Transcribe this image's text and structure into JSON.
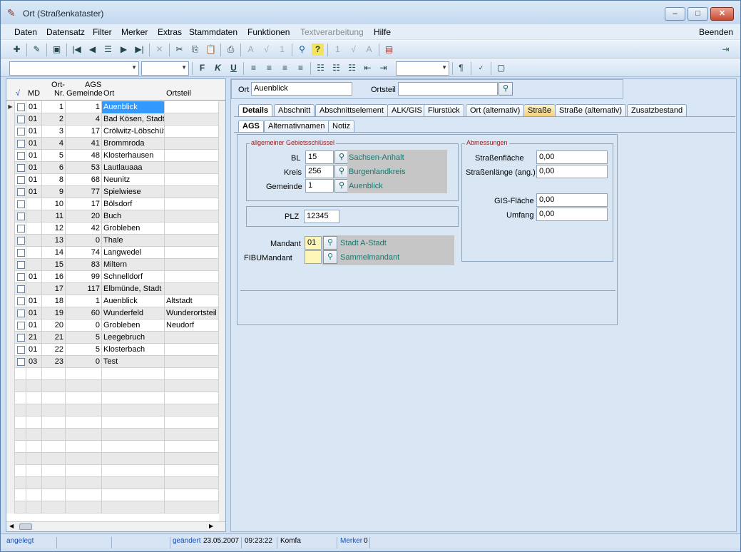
{
  "window": {
    "title": "Ort (Straßenkataster)"
  },
  "menu": {
    "items": [
      "Daten",
      "Datensatz",
      "Filter",
      "Merker",
      "Extras",
      "Stammdaten",
      "Funktionen",
      "Textverarbeitung",
      "Hilfe"
    ],
    "disabled": "Textverarbeitung",
    "exit": "Beenden"
  },
  "grid": {
    "headers": {
      "check": "√",
      "md": "MD",
      "nr_top": "Ort-",
      "nr_bottom": "Nr.",
      "ags_top": "AGS",
      "ags_bottom": "Gemeinde",
      "ort": "Ort",
      "ortsteil": "Ortsteil"
    },
    "rows": [
      {
        "md": "01",
        "nr": "1",
        "ags": "1",
        "ort": "Auenblick",
        "ortsteil": ""
      },
      {
        "md": "01",
        "nr": "2",
        "ags": "4",
        "ort": "Bad Kösen, Stadt",
        "ortsteil": ""
      },
      {
        "md": "01",
        "nr": "3",
        "ags": "17",
        "ort": "Crölwitz-Löbschütz",
        "ortsteil": ""
      },
      {
        "md": "01",
        "nr": "4",
        "ags": "41",
        "ort": "Brommroda",
        "ortsteil": ""
      },
      {
        "md": "01",
        "nr": "5",
        "ags": "48",
        "ort": "Klosterhausen",
        "ortsteil": ""
      },
      {
        "md": "01",
        "nr": "6",
        "ags": "53",
        "ort": "Lautlauaaa",
        "ortsteil": ""
      },
      {
        "md": "01",
        "nr": "8",
        "ags": "68",
        "ort": "Neunitz",
        "ortsteil": ""
      },
      {
        "md": "01",
        "nr": "9",
        "ags": "77",
        "ort": "Spielwiese",
        "ortsteil": ""
      },
      {
        "md": "",
        "nr": "10",
        "ags": "17",
        "ort": "Bölsdorf",
        "ortsteil": ""
      },
      {
        "md": "",
        "nr": "11",
        "ags": "20",
        "ort": "Buch",
        "ortsteil": ""
      },
      {
        "md": "",
        "nr": "12",
        "ags": "42",
        "ort": "Grobleben",
        "ortsteil": ""
      },
      {
        "md": "",
        "nr": "13",
        "ags": "0",
        "ort": "Thale",
        "ortsteil": ""
      },
      {
        "md": "",
        "nr": "14",
        "ags": "74",
        "ort": "Langwedel",
        "ortsteil": ""
      },
      {
        "md": "",
        "nr": "15",
        "ags": "83",
        "ort": "Miltern",
        "ortsteil": ""
      },
      {
        "md": "01",
        "nr": "16",
        "ags": "99",
        "ort": "Schnelldorf",
        "ortsteil": ""
      },
      {
        "md": "",
        "nr": "17",
        "ags": "117",
        "ort": "Elbmünde, Stadt",
        "ortsteil": ""
      },
      {
        "md": "01",
        "nr": "18",
        "ags": "1",
        "ort": "Auenblick",
        "ortsteil": "Altstadt"
      },
      {
        "md": "01",
        "nr": "19",
        "ags": "60",
        "ort": "Wunderfeld",
        "ortsteil": "Wunderortsteil"
      },
      {
        "md": "01",
        "nr": "20",
        "ags": "0",
        "ort": "Grobleben",
        "ortsteil": "Neudorf"
      },
      {
        "md": "21",
        "nr": "21",
        "ags": "5",
        "ort": "Leegebruch",
        "ortsteil": ""
      },
      {
        "md": "01",
        "nr": "22",
        "ags": "5",
        "ort": "Klosterbach",
        "ortsteil": ""
      },
      {
        "md": "03",
        "nr": "23",
        "ags": "0",
        "ort": "Test",
        "ortsteil": ""
      }
    ]
  },
  "search": {
    "ort_label": "Ort",
    "ort_value": "Auenblick",
    "ortsteil_label": "Ortsteil",
    "ortsteil_value": ""
  },
  "tabs": [
    "Details",
    "Abschnitt",
    "Abschnittselement",
    "ALK/GIS",
    "Flurstück",
    "Ort (alternativ)",
    "Straße",
    "Straße (alternativ)",
    "Zusatzbestand"
  ],
  "subtabs": [
    "AGS",
    "Alternativnamen",
    "Notiz"
  ],
  "ags": {
    "group_title": "allgemeiner Gebietsschlüssel",
    "bl_label": "BL",
    "bl_value": "15",
    "bl_name": "Sachsen-Anhalt",
    "kreis_label": "Kreis",
    "kreis_value": "256",
    "kreis_name": "Burgenlandkreis",
    "gemeinde_label": "Gemeinde",
    "gemeinde_value": "1",
    "gemeinde_name": "Auenblick",
    "plz_label": "PLZ",
    "plz_value": "12345",
    "mandant_label": "Mandant",
    "mandant_value": "01",
    "mandant_name": "Stadt A-Stadt",
    "fibu_label": "FIBUMandant",
    "fibu_value": "",
    "fibu_name": "Sammelmandant"
  },
  "abm": {
    "group_title": "Abmessungen",
    "sf_label": "Straßenfläche",
    "sf_value": "0,00",
    "sl_label": "Straßenlänge (ang.)",
    "sl_value": "0,00",
    "gis_label": "GIS-Fläche",
    "gis_value": "0,00",
    "umfang_label": "Umfang",
    "umfang_value": "0,00"
  },
  "status": {
    "angelegt": "angelegt",
    "geaendert_label": "geändert",
    "date": "23.05.2007",
    "time": "09:23:22",
    "user": "Komfa",
    "merker_label": "Merker",
    "merker_value": "0"
  },
  "colors": {
    "accent": "#3399ff",
    "readonly_text": "#137a72",
    "group_title": "#8b1a1a"
  }
}
